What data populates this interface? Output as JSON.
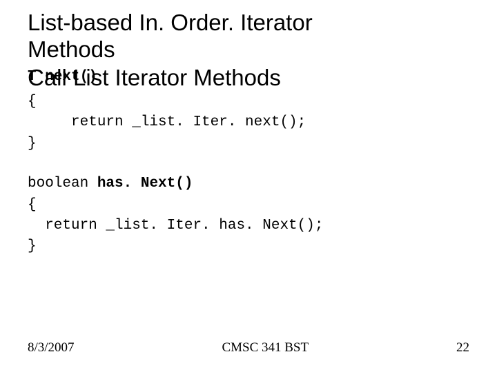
{
  "title": {
    "line1": "List-based In. Order. Iterator",
    "line2": "Methods"
  },
  "subtitle": "Call List Iterator Methods",
  "code1": {
    "overlap": "T next()",
    "l1": "{",
    "l2": "     return _list. Iter. next();",
    "l3": "}"
  },
  "code2": {
    "l1a": "boolean ",
    "l1b": "has. Next()",
    "l2": "{",
    "l3": "  return _list. Iter. has. Next();",
    "l4": "}"
  },
  "footer": {
    "left": "8/3/2007",
    "center": "CMSC 341 BST",
    "right": "22"
  }
}
